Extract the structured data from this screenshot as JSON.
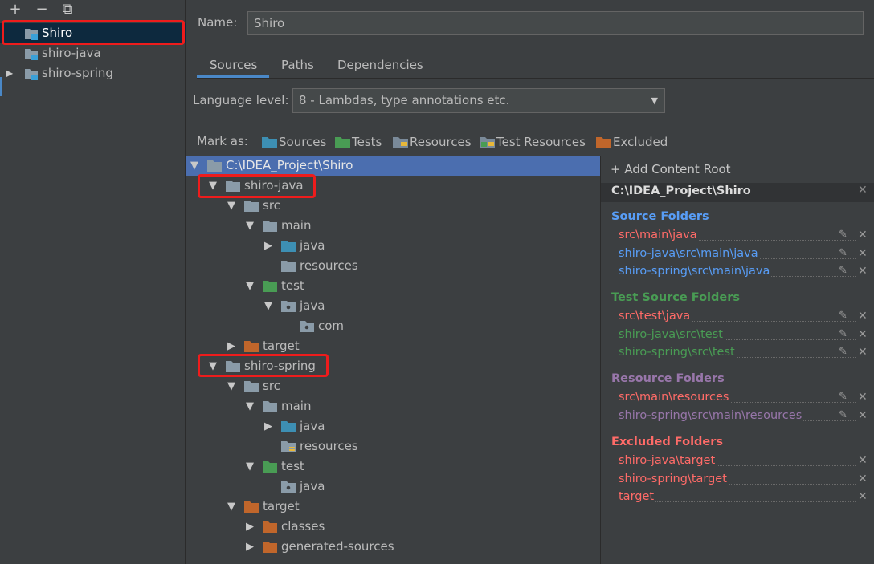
{
  "toolbar": {
    "add": "+",
    "remove": "−",
    "copy": "⧉"
  },
  "modules": [
    {
      "label": "Shiro",
      "selected": true,
      "expandable": false
    },
    {
      "label": "shiro-java",
      "selected": false,
      "expandable": false
    },
    {
      "label": "shiro-spring",
      "selected": false,
      "expandable": true
    }
  ],
  "name_field": {
    "label": "Name:",
    "value": "Shiro"
  },
  "tabs": [
    {
      "label": "Sources",
      "active": true
    },
    {
      "label": "Paths",
      "active": false
    },
    {
      "label": "Dependencies",
      "active": false
    }
  ],
  "language_level": {
    "label": "Language level:",
    "value": "8 - Lambdas, type annotations etc."
  },
  "mark_as": {
    "label": "Mark as:",
    "items": [
      {
        "label": "Sources",
        "icon": "sources-folder-icon",
        "color": "#3d8fb3"
      },
      {
        "label": "Tests",
        "icon": "tests-folder-icon",
        "color": "#499c54"
      },
      {
        "label": "Resources",
        "icon": "resources-folder-icon",
        "color": "#7a8a99"
      },
      {
        "label": "Test Resources",
        "icon": "test-resources-folder-icon",
        "color": "#7a8a99"
      },
      {
        "label": "Excluded",
        "icon": "excluded-folder-icon",
        "color": "#c0662b"
      }
    ]
  },
  "tree": [
    {
      "label": "C:\\IDEA_Project\\Shiro",
      "arrow": "down",
      "type": "plain"
    },
    {
      "label": "shiro-java",
      "arrow": "down",
      "type": "plain"
    },
    {
      "label": "src",
      "arrow": "down",
      "type": "plain"
    },
    {
      "label": "main",
      "arrow": "down",
      "type": "plain"
    },
    {
      "label": "java",
      "arrow": "right",
      "type": "source"
    },
    {
      "label": "resources",
      "arrow": "none",
      "type": "plain"
    },
    {
      "label": "test",
      "arrow": "down",
      "type": "test"
    },
    {
      "label": "java",
      "arrow": "down",
      "type": "package"
    },
    {
      "label": "com",
      "arrow": "none",
      "type": "package"
    },
    {
      "label": "target",
      "arrow": "right",
      "type": "excluded"
    },
    {
      "label": "shiro-spring",
      "arrow": "down",
      "type": "plain"
    },
    {
      "label": "src",
      "arrow": "down",
      "type": "plain"
    },
    {
      "label": "main",
      "arrow": "down",
      "type": "plain"
    },
    {
      "label": "java",
      "arrow": "right",
      "type": "source"
    },
    {
      "label": "resources",
      "arrow": "none",
      "type": "resource"
    },
    {
      "label": "test",
      "arrow": "down",
      "type": "test"
    },
    {
      "label": "java",
      "arrow": "none",
      "type": "package"
    },
    {
      "label": "target",
      "arrow": "down",
      "type": "excluded"
    },
    {
      "label": "classes",
      "arrow": "right",
      "type": "excluded"
    },
    {
      "label": "generated-sources",
      "arrow": "right",
      "type": "excluded"
    }
  ],
  "content_roots": {
    "add_label": "+ Add Content Root",
    "root_path": "C:\\IDEA_Project\\Shiro",
    "sections": [
      {
        "title": "Source Folders",
        "color": "#589df6",
        "paths": [
          {
            "text": "src\\main\\java",
            "color": "#ff6b68",
            "editable": true
          },
          {
            "text": "shiro-java\\src\\main\\java",
            "color": "#589df6",
            "editable": true
          },
          {
            "text": "shiro-spring\\src\\main\\java",
            "color": "#589df6",
            "editable": true
          }
        ]
      },
      {
        "title": "Test Source Folders",
        "color": "#499c54",
        "paths": [
          {
            "text": "src\\test\\java",
            "color": "#ff6b68",
            "editable": true
          },
          {
            "text": "shiro-java\\src\\test",
            "color": "#499c54",
            "editable": true
          },
          {
            "text": "shiro-spring\\src\\test",
            "color": "#499c54",
            "editable": true
          }
        ]
      },
      {
        "title": "Resource Folders",
        "color": "#9876aa",
        "paths": [
          {
            "text": "src\\main\\resources",
            "color": "#ff6b68",
            "editable": true
          },
          {
            "text": "shiro-spring\\src\\main\\resources",
            "color": "#9876aa",
            "editable": true
          }
        ]
      },
      {
        "title": "Excluded Folders",
        "color": "#ff6b68",
        "paths": [
          {
            "text": "shiro-java\\target",
            "color": "#ff6b68",
            "editable": false
          },
          {
            "text": "shiro-spring\\target",
            "color": "#ff6b68",
            "editable": false
          },
          {
            "text": "target",
            "color": "#ff6b68",
            "editable": false
          }
        ]
      }
    ]
  }
}
